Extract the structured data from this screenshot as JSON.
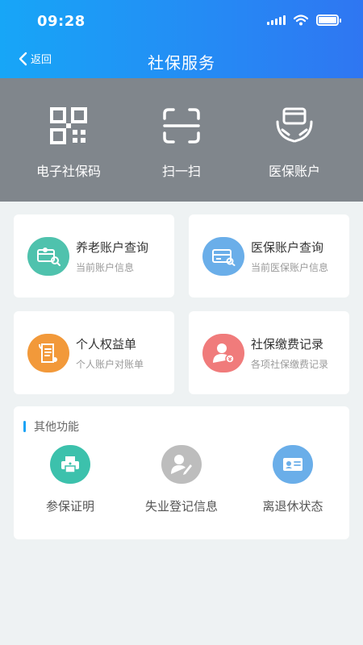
{
  "status_bar": {
    "time": "09:28"
  },
  "nav": {
    "back_label": "返回",
    "title": "社保服务"
  },
  "quick_actions": [
    {
      "label": "电子社保码",
      "icon": "qr-code-icon"
    },
    {
      "label": "扫一扫",
      "icon": "scan-icon"
    },
    {
      "label": "医保账户",
      "icon": "card-in-hands-icon"
    }
  ],
  "services": [
    {
      "title": "养老账户查询",
      "subtitle": "当前账户信息",
      "icon": "pension-card-icon",
      "color": "#4fc2ad"
    },
    {
      "title": "医保账户查询",
      "subtitle": "当前医保账户信息",
      "icon": "medical-card-icon",
      "color": "#6aaee9"
    },
    {
      "title": "个人权益单",
      "subtitle": "个人账户对账单",
      "icon": "statement-icon",
      "color": "#f2993a"
    },
    {
      "title": "社保缴费记录",
      "subtitle": "各项社保缴费记录",
      "icon": "payment-record-icon",
      "color": "#f07b7b"
    }
  ],
  "other_functions": {
    "heading": "其他功能",
    "items": [
      {
        "label": "参保证明",
        "icon": "printer-icon",
        "color": "#3cc1ac"
      },
      {
        "label": "失业登记信息",
        "icon": "user-edit-icon",
        "color": "#bdbdbd"
      },
      {
        "label": "离退休状态",
        "icon": "id-card-icon",
        "color": "#6aaee9"
      }
    ]
  },
  "colors": {
    "header_start": "#17a6f7",
    "header_end": "#2f76f2",
    "quick_bg": "#80868c",
    "accent_bar": "#1aa3f5"
  }
}
